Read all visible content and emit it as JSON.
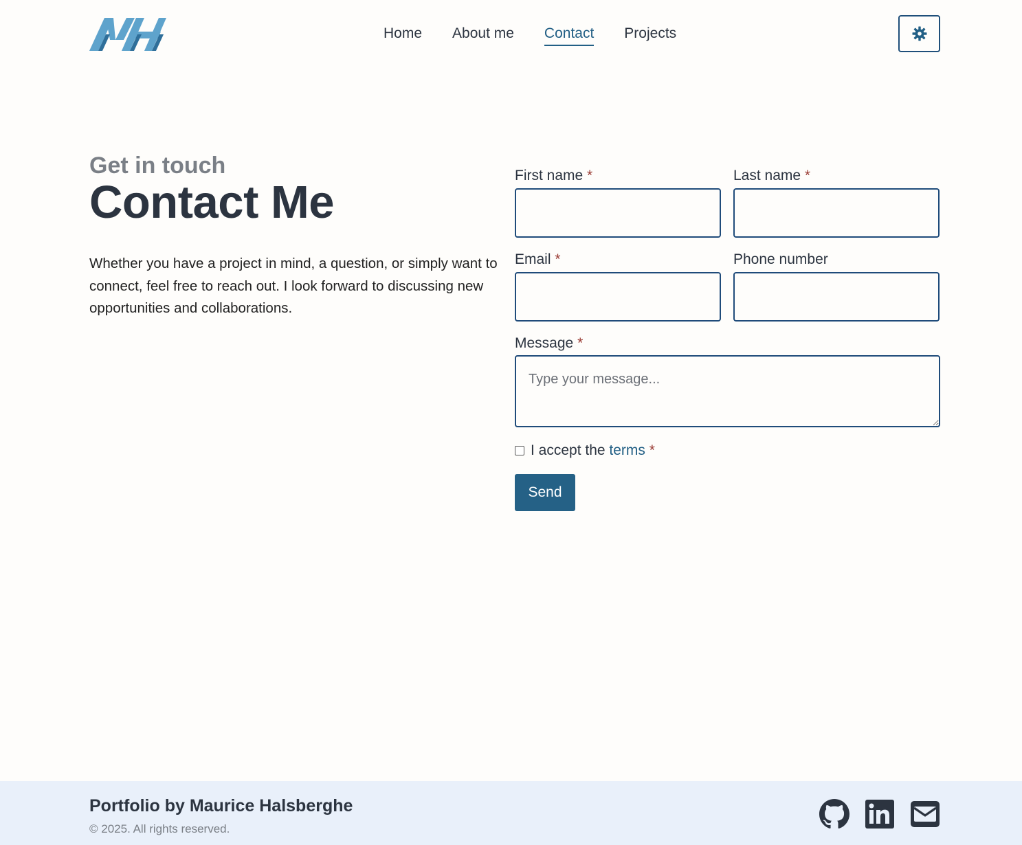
{
  "header": {
    "logo_text": "MH",
    "nav": [
      {
        "label": "Home",
        "active": false
      },
      {
        "label": "About me",
        "active": false
      },
      {
        "label": "Contact",
        "active": true
      },
      {
        "label": "Projects",
        "active": false
      }
    ],
    "theme_toggle_icon": "gear-icon"
  },
  "hero": {
    "eyebrow": "Get in touch",
    "title": "Contact Me",
    "intro": "Whether you have a project in mind, a question, or simply want to connect, feel free to reach out. I look forward to discussing new opportunities and collaborations."
  },
  "form": {
    "first_name": {
      "label": "First name",
      "required": "*",
      "value": ""
    },
    "last_name": {
      "label": "Last name",
      "required": "*",
      "value": ""
    },
    "email": {
      "label": "Email",
      "required": "*",
      "value": ""
    },
    "phone": {
      "label": "Phone number",
      "value": ""
    },
    "message": {
      "label": "Message",
      "required": "*",
      "placeholder": "Type your message...",
      "value": ""
    },
    "terms": {
      "prefix": "I accept the",
      "link": "terms",
      "required": "*",
      "checked": false
    },
    "submit_label": "Send"
  },
  "footer": {
    "title": "Portfolio by Maurice Halsberghe",
    "copyright": "© 2025. All rights reserved.",
    "social": [
      "github-icon",
      "linkedin-icon",
      "email-icon"
    ]
  },
  "colors": {
    "accent": "#225f85",
    "button": "#256186",
    "text": "#2c3440",
    "muted": "#7a7f86",
    "required": "#9a3b34",
    "footer_bg": "#e9f0fa",
    "logo": "#5ea3cc"
  }
}
